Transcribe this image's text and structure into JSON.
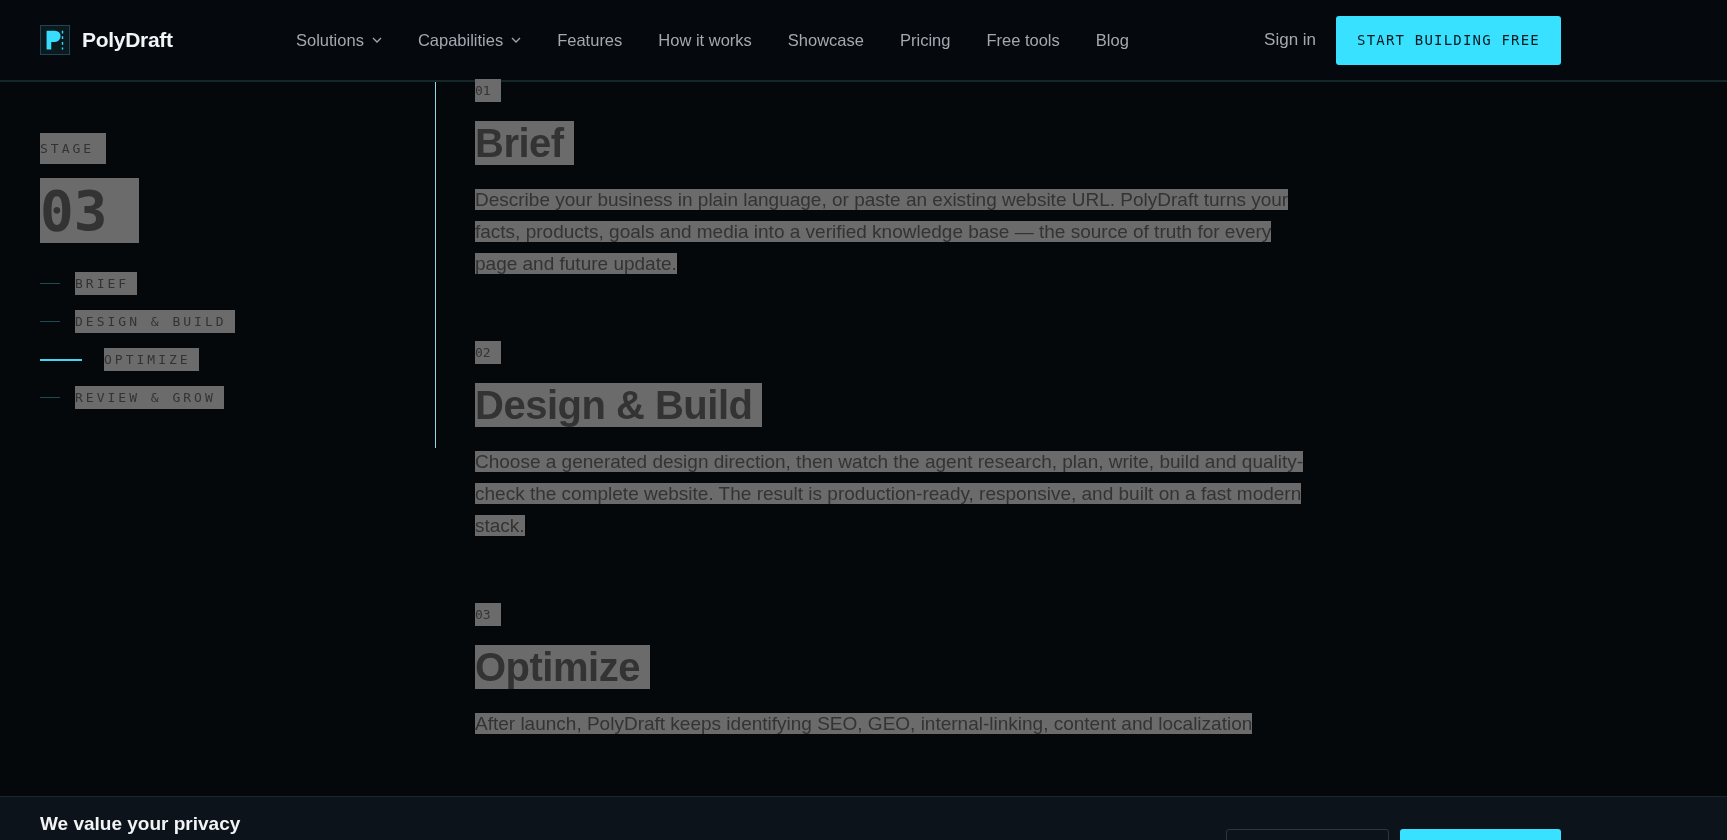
{
  "brand": "PolyDraft",
  "nav": [
    {
      "label": "Solutions",
      "dropdown": true
    },
    {
      "label": "Capabilities",
      "dropdown": true
    },
    {
      "label": "Features",
      "dropdown": false
    },
    {
      "label": "How it works",
      "dropdown": false
    },
    {
      "label": "Showcase",
      "dropdown": false
    },
    {
      "label": "Pricing",
      "dropdown": false
    },
    {
      "label": "Free tools",
      "dropdown": false
    },
    {
      "label": "Blog",
      "dropdown": false
    }
  ],
  "sign_in": "Sign in",
  "cta": "START BUILDING FREE",
  "text_selected": true,
  "stage": {
    "label": "STAGE",
    "number": "03"
  },
  "stages": [
    {
      "label": "BRIEF",
      "selected": false
    },
    {
      "label": "DESIGN & BUILD",
      "selected": false
    },
    {
      "label": "OPTIMIZE",
      "selected": true
    },
    {
      "label": "REVIEW & GROW",
      "selected": false
    }
  ],
  "sections": [
    {
      "number": "01",
      "title": "Brief",
      "body": "Describe your business in plain language, or paste an existing website URL. PolyDraft turns your facts, products, goals and media into a verified knowledge base — the source of truth for every page and future update."
    },
    {
      "number": "02",
      "title": "Design & Build",
      "body": "Choose a generated design direction, then watch the agent research, plan, write, build and quality-check the complete website. The result is production-ready, responsive, and built on a fast modern stack."
    },
    {
      "number": "03",
      "title": "Optimize",
      "body": "After launch, PolyDraft keeps identifying SEO, GEO, internal-linking, content and localization"
    }
  ],
  "banner": {
    "title": "We value your privacy",
    "buttons": [
      {
        "kind": "outline"
      },
      {
        "kind": "primary"
      }
    ]
  }
}
